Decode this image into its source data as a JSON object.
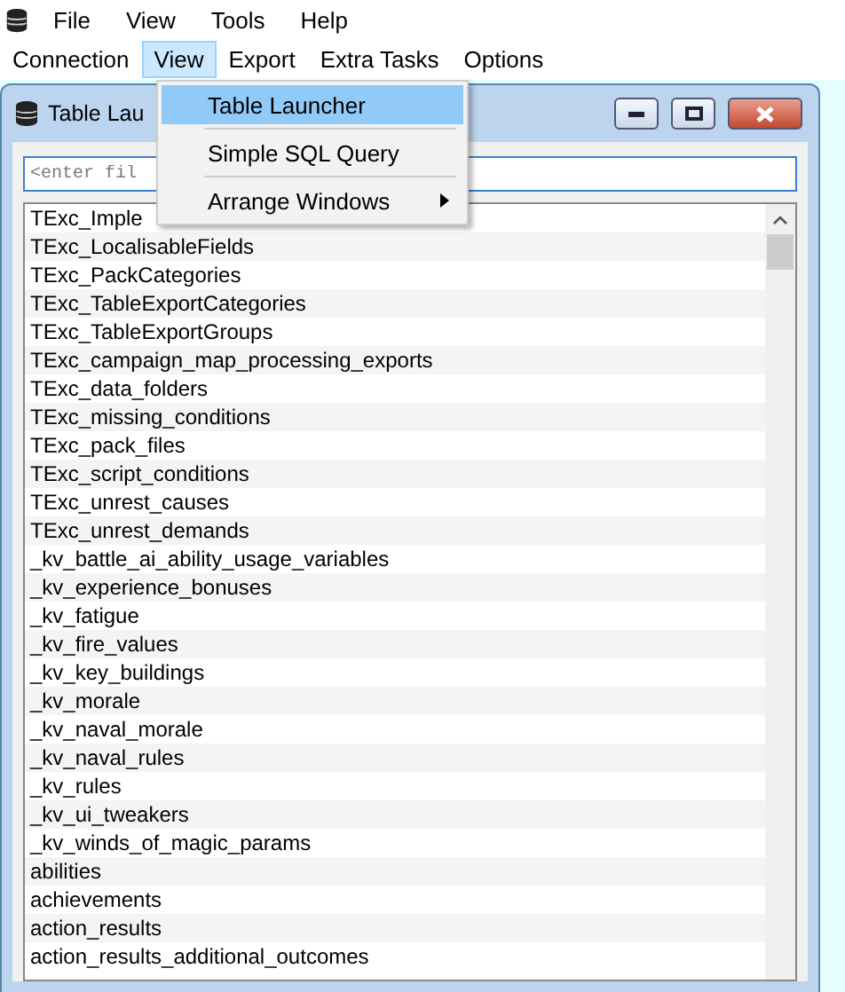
{
  "app_menu": [
    {
      "label": "File"
    },
    {
      "label": "View"
    },
    {
      "label": "Tools"
    },
    {
      "label": "Help"
    }
  ],
  "main_menu": [
    {
      "label": "Connection",
      "selected": false
    },
    {
      "label": "View",
      "selected": true
    },
    {
      "label": "Export",
      "selected": false
    },
    {
      "label": "Extra Tasks",
      "selected": false
    },
    {
      "label": "Options",
      "selected": false
    }
  ],
  "dropdown": {
    "items": [
      {
        "kind": "item",
        "label": "Table Launcher",
        "selected": true
      },
      {
        "kind": "separator"
      },
      {
        "kind": "item",
        "label": "Simple SQL Query",
        "selected": false
      },
      {
        "kind": "separator"
      },
      {
        "kind": "submenu",
        "label": "Arrange Windows",
        "selected": false
      }
    ]
  },
  "child_window": {
    "title": "Table Lau",
    "filter": {
      "placeholder": "<enter fil"
    },
    "tables": [
      "TExc_Imple",
      "TExc_LocalisableFields",
      "TExc_PackCategories",
      "TExc_TableExportCategories",
      "TExc_TableExportGroups",
      "TExc_campaign_map_processing_exports",
      "TExc_data_folders",
      "TExc_missing_conditions",
      "TExc_pack_files",
      "TExc_script_conditions",
      "TExc_unrest_causes",
      "TExc_unrest_demands",
      "_kv_battle_ai_ability_usage_variables",
      "_kv_experience_bonuses",
      "_kv_fatigue",
      "_kv_fire_values",
      "_kv_key_buildings",
      "_kv_morale",
      "_kv_naval_morale",
      "_kv_naval_rules",
      "_kv_rules",
      "_kv_ui_tweakers",
      "_kv_winds_of_magic_params",
      "abilities",
      "achievements",
      "action_results",
      "action_results_additional_outcomes"
    ]
  }
}
